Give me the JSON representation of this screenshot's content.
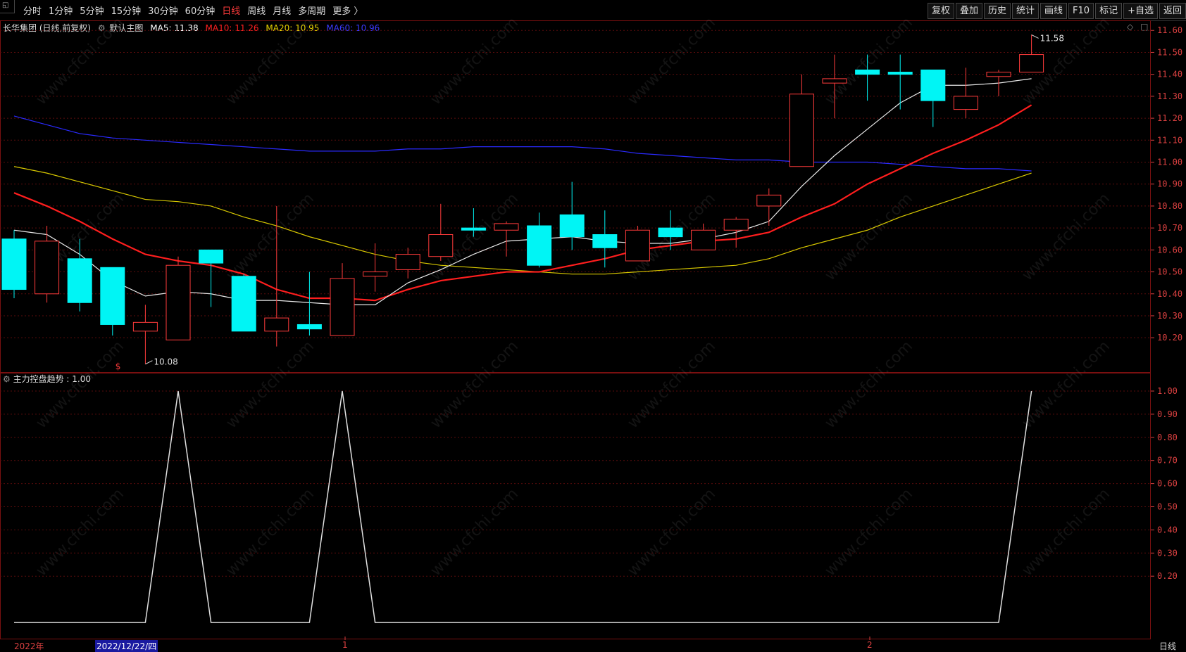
{
  "toolbar": {
    "tabs": [
      {
        "label": "分时",
        "active": false
      },
      {
        "label": "1分钟",
        "active": false
      },
      {
        "label": "5分钟",
        "active": false
      },
      {
        "label": "15分钟",
        "active": false
      },
      {
        "label": "30分钟",
        "active": false
      },
      {
        "label": "60分钟",
        "active": false
      },
      {
        "label": "日线",
        "active": true
      },
      {
        "label": "周线",
        "active": false
      },
      {
        "label": "月线",
        "active": false
      },
      {
        "label": "多周期",
        "active": false
      },
      {
        "label": "更多 〉",
        "active": false
      }
    ],
    "right_buttons": [
      "复权",
      "叠加",
      "历史",
      "统计",
      "画线",
      "F10",
      "标记",
      "+自选",
      "返回"
    ]
  },
  "main_panel": {
    "title": "长华集团 (日线,前复权)",
    "indicator_name": "默认主图",
    "ma5": "MA5: 11.38",
    "ma10": "MA10: 11.26",
    "ma20": "MA20: 10.95",
    "ma60": "MA60: 10.96",
    "colors": {
      "ma5": "#ffffff",
      "ma10": "#ff2020",
      "ma20": "#e6d200",
      "ma60": "#2020ff",
      "up": "#ff3b3b",
      "down": "#00f5f5"
    },
    "high_label": "11.58",
    "low_label": "10.08",
    "marker": "$",
    "y_ticks": [
      "11.60",
      "11.50",
      "11.40",
      "11.30",
      "11.20",
      "11.10",
      "11.00",
      "10.90",
      "10.80",
      "10.70",
      "10.60",
      "10.50",
      "10.40",
      "10.30",
      "10.20"
    ]
  },
  "sub_panel": {
    "title": "主力控盘趋势 : 1.00",
    "y_ticks": [
      "1.00",
      "0.90",
      "0.80",
      "0.70",
      "0.60",
      "0.50",
      "0.40",
      "0.30",
      "0.20"
    ]
  },
  "bottom": {
    "year_label": "2022年",
    "cursor_date": "2022/12/22/四",
    "month_1": "1",
    "month_2": "2",
    "period": "日线"
  },
  "watermark": "www.cfchi.com",
  "chart_data": {
    "type": "candlestick",
    "ylim": [
      10.05,
      11.62
    ],
    "candles": [
      {
        "o": 10.65,
        "c": 10.42,
        "h": 10.69,
        "l": 10.38
      },
      {
        "o": 10.4,
        "c": 10.64,
        "h": 10.71,
        "l": 10.36
      },
      {
        "o": 10.56,
        "c": 10.36,
        "h": 10.65,
        "l": 10.32
      },
      {
        "o": 10.52,
        "c": 10.26,
        "h": 10.52,
        "l": 10.21
      },
      {
        "o": 10.23,
        "c": 10.27,
        "h": 10.35,
        "l": 10.08
      },
      {
        "o": 10.19,
        "c": 10.53,
        "h": 10.57,
        "l": 10.19
      },
      {
        "o": 10.6,
        "c": 10.54,
        "h": 10.6,
        "l": 10.34
      },
      {
        "o": 10.48,
        "c": 10.23,
        "h": 10.49,
        "l": 10.23
      },
      {
        "o": 10.23,
        "c": 10.29,
        "h": 10.8,
        "l": 10.16
      },
      {
        "o": 10.26,
        "c": 10.24,
        "h": 10.5,
        "l": 10.21
      },
      {
        "o": 10.21,
        "c": 10.47,
        "h": 10.54,
        "l": 10.21
      },
      {
        "o": 10.48,
        "c": 10.5,
        "h": 10.63,
        "l": 10.41
      },
      {
        "o": 10.51,
        "c": 10.58,
        "h": 10.61,
        "l": 10.47
      },
      {
        "o": 10.57,
        "c": 10.67,
        "h": 10.81,
        "l": 10.55
      },
      {
        "o": 10.7,
        "c": 10.69,
        "h": 10.79,
        "l": 10.66
      },
      {
        "o": 10.69,
        "c": 10.72,
        "h": 10.73,
        "l": 10.57
      },
      {
        "o": 10.71,
        "c": 10.53,
        "h": 10.77,
        "l": 10.52
      },
      {
        "o": 10.76,
        "c": 10.66,
        "h": 10.91,
        "l": 10.6
      },
      {
        "o": 10.67,
        "c": 10.61,
        "h": 10.78,
        "l": 10.52
      },
      {
        "o": 10.55,
        "c": 10.69,
        "h": 10.71,
        "l": 10.55
      },
      {
        "o": 10.7,
        "c": 10.66,
        "h": 10.78,
        "l": 10.6
      },
      {
        "o": 10.6,
        "c": 10.69,
        "h": 10.72,
        "l": 10.6
      },
      {
        "o": 10.69,
        "c": 10.74,
        "h": 10.75,
        "l": 10.61
      },
      {
        "o": 10.8,
        "c": 10.85,
        "h": 10.88,
        "l": 10.71
      },
      {
        "o": 10.98,
        "c": 11.31,
        "h": 11.4,
        "l": 10.98
      },
      {
        "o": 11.36,
        "c": 11.38,
        "h": 11.49,
        "l": 11.2
      },
      {
        "o": 11.42,
        "c": 11.4,
        "h": 11.49,
        "l": 11.28
      },
      {
        "o": 11.41,
        "c": 11.4,
        "h": 11.49,
        "l": 11.24
      },
      {
        "o": 11.42,
        "c": 11.28,
        "h": 11.42,
        "l": 11.16
      },
      {
        "o": 11.24,
        "c": 11.3,
        "h": 11.43,
        "l": 11.2
      },
      {
        "o": 11.39,
        "c": 11.41,
        "h": 11.42,
        "l": 11.3
      },
      {
        "o": 11.41,
        "c": 11.49,
        "h": 11.58,
        "l": 11.41
      }
    ],
    "ma5": [
      10.69,
      10.67,
      10.58,
      10.46,
      10.39,
      10.41,
      10.4,
      10.37,
      10.37,
      10.36,
      10.35,
      10.35,
      10.45,
      10.51,
      10.58,
      10.64,
      10.65,
      10.66,
      10.64,
      10.63,
      10.63,
      10.65,
      10.68,
      10.73,
      10.89,
      11.03,
      11.15,
      11.27,
      11.35,
      11.35,
      11.36,
      11.38
    ],
    "ma10": [
      10.86,
      10.8,
      10.73,
      10.65,
      10.58,
      10.55,
      10.53,
      10.49,
      10.42,
      10.38,
      10.38,
      10.37,
      10.42,
      10.46,
      10.48,
      10.5,
      10.5,
      10.53,
      10.56,
      10.6,
      10.62,
      10.64,
      10.65,
      10.68,
      10.75,
      10.81,
      10.9,
      10.97,
      11.04,
      11.1,
      11.17,
      11.26
    ],
    "ma20": [
      10.98,
      10.95,
      10.91,
      10.87,
      10.83,
      10.82,
      10.8,
      10.75,
      10.71,
      10.66,
      10.62,
      10.58,
      10.55,
      10.53,
      10.52,
      10.51,
      10.5,
      10.49,
      10.49,
      10.5,
      10.51,
      10.52,
      10.53,
      10.56,
      10.61,
      10.65,
      10.69,
      10.75,
      10.8,
      10.85,
      10.9,
      10.95
    ],
    "ma60": [
      11.21,
      11.17,
      11.13,
      11.11,
      11.1,
      11.09,
      11.08,
      11.07,
      11.06,
      11.05,
      11.05,
      11.05,
      11.06,
      11.06,
      11.07,
      11.07,
      11.07,
      11.07,
      11.06,
      11.04,
      11.03,
      11.02,
      11.01,
      11.01,
      11.0,
      11.0,
      11.0,
      10.99,
      10.98,
      10.97,
      10.97,
      10.96
    ],
    "trend": [
      0,
      0,
      0,
      0,
      0,
      1,
      0,
      0,
      0,
      0,
      1,
      0,
      0,
      0,
      0,
      0,
      0,
      0,
      0,
      0,
      0,
      0,
      0,
      0,
      0,
      0,
      0,
      0,
      0,
      0,
      0,
      1
    ]
  }
}
